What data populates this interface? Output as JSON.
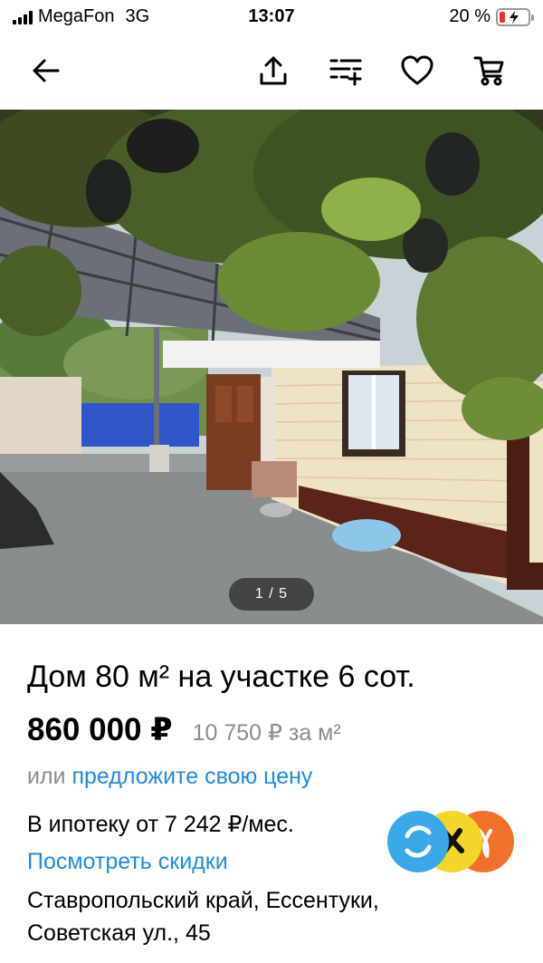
{
  "status_bar": {
    "carrier": "MegaFon",
    "network": "3G",
    "time": "13:07",
    "battery": "20 %",
    "battery_level": 0.2,
    "battery_color": "#e3342f"
  },
  "nav": {
    "icons": [
      "back-arrow-icon",
      "share-icon",
      "compare-icon",
      "heart-icon",
      "cart-icon"
    ]
  },
  "gallery": {
    "counter": "1 / 5"
  },
  "listing": {
    "title": "Дом 80 м² на участке 6 сот.",
    "price": "860 000 ₽",
    "price_per_m2": "10 750 ₽ за м²",
    "offer_prefix": "или",
    "offer_link": "предложите свою цену",
    "mortgage": "В ипотеку от 7 242 ₽/мес.",
    "discounts_link": "Посмотреть скидки",
    "address_line1": "Ставропольский край, Ессентуки,",
    "address_line2": "Советская ул., 45"
  },
  "colors": {
    "link": "#1e8be6",
    "muted": "#8c8c8c",
    "bank_blue": "#3aa7e6",
    "bank_yellow": "#f2d629",
    "bank_orange": "#f0712c"
  }
}
